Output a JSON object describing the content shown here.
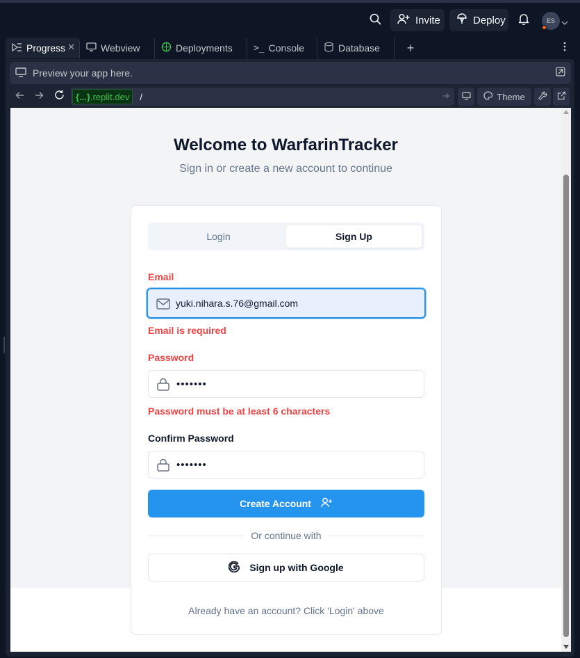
{
  "header": {
    "invite_label": "Invite",
    "deploy_label": "Deploy",
    "avatar_initials": "ES"
  },
  "tabs": [
    {
      "label": "Progress",
      "icon": "progress-icon",
      "active": true
    },
    {
      "label": "Webview",
      "icon": "monitor-icon"
    },
    {
      "label": "Deployments",
      "icon": "deployments-icon"
    },
    {
      "label": "Console",
      "icon": "terminal-icon"
    },
    {
      "label": "Database",
      "icon": "database-icon"
    }
  ],
  "preview": {
    "text": "Preview your app here."
  },
  "url": {
    "host_braces": "{...}",
    "host_domain": ".replit.dev",
    "path": "/",
    "theme_label": "Theme"
  },
  "app": {
    "title": "Welcome to WarfarinTracker",
    "subtitle": "Sign in or create a new account to continue",
    "tab_login": "Login",
    "tab_signup": "Sign Up",
    "email_label": "Email",
    "email_value": "yuki.nihara.s.76@gmail.com",
    "email_error": "Email is required",
    "password_label": "Password",
    "password_value": "•••••••",
    "password_error": "Password must be at least 6 characters",
    "confirm_label": "Confirm Password",
    "confirm_value": "•••••••",
    "create_button": "Create Account",
    "divider_text": "Or continue with",
    "google_button": "Sign up with Google",
    "footer_text": "Already have an account? Click 'Login' above"
  },
  "colors": {
    "accent": "#2494ef",
    "error": "#ef4444",
    "ide_bg": "#0e1525",
    "panel_bg": "#1c2333"
  }
}
